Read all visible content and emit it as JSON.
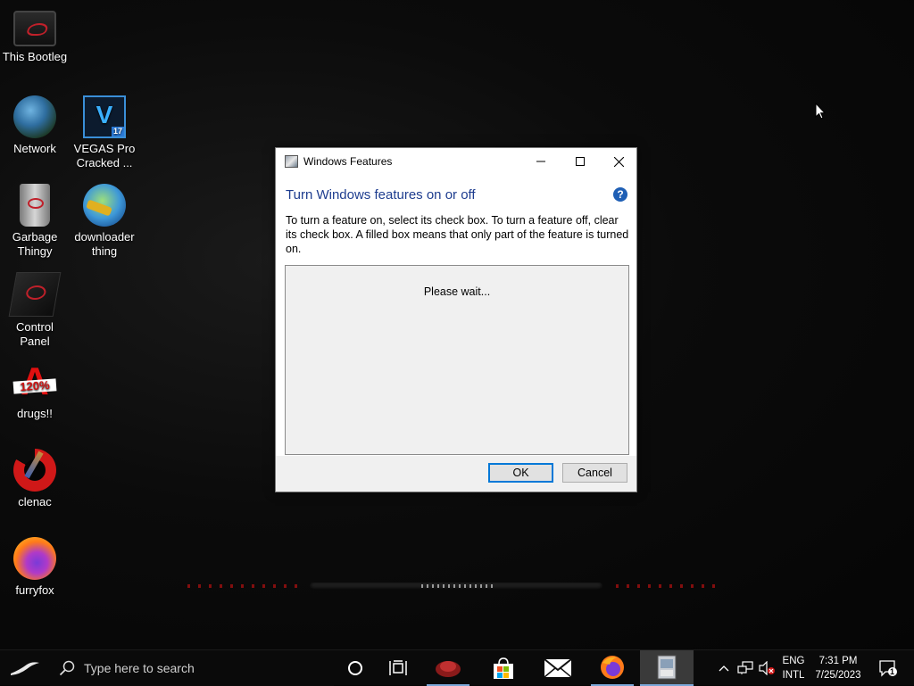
{
  "desktop": {
    "icons": [
      {
        "label": "This Bootleg",
        "icon": "computer-icon"
      },
      {
        "label": "Network",
        "icon": "network-icon"
      },
      {
        "label": "VEGAS Pro Cracked ...",
        "icon": "vegas-pro-icon",
        "badge": "17"
      },
      {
        "label": "Garbage Thingy",
        "icon": "recycle-bin-icon"
      },
      {
        "label": "downloader thing",
        "icon": "download-manager-icon"
      },
      {
        "label": "Control Panel",
        "icon": "control-panel-icon"
      },
      {
        "label": "drugs!!",
        "icon": "acrobat-icon",
        "glyph": "120%"
      },
      {
        "label": "clenac",
        "icon": "ccleaner-icon"
      },
      {
        "label": "furryfox",
        "icon": "firefox-icon"
      }
    ]
  },
  "dialog": {
    "title": "Windows Features",
    "heading": "Turn Windows features on or off",
    "help_glyph": "?",
    "description": "To turn a feature on, select its check box. To turn a feature off, clear its check box. A filled box means that only part of the feature is turned on.",
    "status": "Please wait...",
    "ok_label": "OK",
    "cancel_label": "Cancel"
  },
  "taskbar": {
    "search_placeholder": "Type here to search",
    "apps": [
      "cortana-icon",
      "task-view-icon",
      "app-icon",
      "store-icon",
      "mail-icon",
      "firefox-icon",
      "windows-features-icon"
    ],
    "language": {
      "line1": "ENG",
      "line2": "INTL"
    },
    "clock": {
      "time": "7:31 PM",
      "date": "7/25/2023"
    },
    "notification_count": "1"
  },
  "colors": {
    "accent": "#0078d7",
    "heading_blue": "#1e3d8f",
    "brand_red": "#c0202a"
  }
}
